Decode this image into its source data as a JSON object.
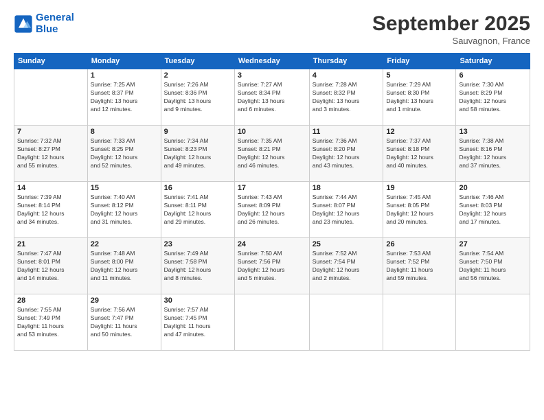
{
  "logo": {
    "line1": "General",
    "line2": "Blue"
  },
  "title": "September 2025",
  "location": "Sauvagnon, France",
  "days_header": [
    "Sunday",
    "Monday",
    "Tuesday",
    "Wednesday",
    "Thursday",
    "Friday",
    "Saturday"
  ],
  "weeks": [
    [
      {
        "num": "",
        "info": ""
      },
      {
        "num": "1",
        "info": "Sunrise: 7:25 AM\nSunset: 8:37 PM\nDaylight: 13 hours\nand 12 minutes."
      },
      {
        "num": "2",
        "info": "Sunrise: 7:26 AM\nSunset: 8:36 PM\nDaylight: 13 hours\nand 9 minutes."
      },
      {
        "num": "3",
        "info": "Sunrise: 7:27 AM\nSunset: 8:34 PM\nDaylight: 13 hours\nand 6 minutes."
      },
      {
        "num": "4",
        "info": "Sunrise: 7:28 AM\nSunset: 8:32 PM\nDaylight: 13 hours\nand 3 minutes."
      },
      {
        "num": "5",
        "info": "Sunrise: 7:29 AM\nSunset: 8:30 PM\nDaylight: 13 hours\nand 1 minute."
      },
      {
        "num": "6",
        "info": "Sunrise: 7:30 AM\nSunset: 8:29 PM\nDaylight: 12 hours\nand 58 minutes."
      }
    ],
    [
      {
        "num": "7",
        "info": "Sunrise: 7:32 AM\nSunset: 8:27 PM\nDaylight: 12 hours\nand 55 minutes."
      },
      {
        "num": "8",
        "info": "Sunrise: 7:33 AM\nSunset: 8:25 PM\nDaylight: 12 hours\nand 52 minutes."
      },
      {
        "num": "9",
        "info": "Sunrise: 7:34 AM\nSunset: 8:23 PM\nDaylight: 12 hours\nand 49 minutes."
      },
      {
        "num": "10",
        "info": "Sunrise: 7:35 AM\nSunset: 8:21 PM\nDaylight: 12 hours\nand 46 minutes."
      },
      {
        "num": "11",
        "info": "Sunrise: 7:36 AM\nSunset: 8:20 PM\nDaylight: 12 hours\nand 43 minutes."
      },
      {
        "num": "12",
        "info": "Sunrise: 7:37 AM\nSunset: 8:18 PM\nDaylight: 12 hours\nand 40 minutes."
      },
      {
        "num": "13",
        "info": "Sunrise: 7:38 AM\nSunset: 8:16 PM\nDaylight: 12 hours\nand 37 minutes."
      }
    ],
    [
      {
        "num": "14",
        "info": "Sunrise: 7:39 AM\nSunset: 8:14 PM\nDaylight: 12 hours\nand 34 minutes."
      },
      {
        "num": "15",
        "info": "Sunrise: 7:40 AM\nSunset: 8:12 PM\nDaylight: 12 hours\nand 31 minutes."
      },
      {
        "num": "16",
        "info": "Sunrise: 7:41 AM\nSunset: 8:11 PM\nDaylight: 12 hours\nand 29 minutes."
      },
      {
        "num": "17",
        "info": "Sunrise: 7:43 AM\nSunset: 8:09 PM\nDaylight: 12 hours\nand 26 minutes."
      },
      {
        "num": "18",
        "info": "Sunrise: 7:44 AM\nSunset: 8:07 PM\nDaylight: 12 hours\nand 23 minutes."
      },
      {
        "num": "19",
        "info": "Sunrise: 7:45 AM\nSunset: 8:05 PM\nDaylight: 12 hours\nand 20 minutes."
      },
      {
        "num": "20",
        "info": "Sunrise: 7:46 AM\nSunset: 8:03 PM\nDaylight: 12 hours\nand 17 minutes."
      }
    ],
    [
      {
        "num": "21",
        "info": "Sunrise: 7:47 AM\nSunset: 8:01 PM\nDaylight: 12 hours\nand 14 minutes."
      },
      {
        "num": "22",
        "info": "Sunrise: 7:48 AM\nSunset: 8:00 PM\nDaylight: 12 hours\nand 11 minutes."
      },
      {
        "num": "23",
        "info": "Sunrise: 7:49 AM\nSunset: 7:58 PM\nDaylight: 12 hours\nand 8 minutes."
      },
      {
        "num": "24",
        "info": "Sunrise: 7:50 AM\nSunset: 7:56 PM\nDaylight: 12 hours\nand 5 minutes."
      },
      {
        "num": "25",
        "info": "Sunrise: 7:52 AM\nSunset: 7:54 PM\nDaylight: 12 hours\nand 2 minutes."
      },
      {
        "num": "26",
        "info": "Sunrise: 7:53 AM\nSunset: 7:52 PM\nDaylight: 11 hours\nand 59 minutes."
      },
      {
        "num": "27",
        "info": "Sunrise: 7:54 AM\nSunset: 7:50 PM\nDaylight: 11 hours\nand 56 minutes."
      }
    ],
    [
      {
        "num": "28",
        "info": "Sunrise: 7:55 AM\nSunset: 7:49 PM\nDaylight: 11 hours\nand 53 minutes."
      },
      {
        "num": "29",
        "info": "Sunrise: 7:56 AM\nSunset: 7:47 PM\nDaylight: 11 hours\nand 50 minutes."
      },
      {
        "num": "30",
        "info": "Sunrise: 7:57 AM\nSunset: 7:45 PM\nDaylight: 11 hours\nand 47 minutes."
      },
      {
        "num": "",
        "info": ""
      },
      {
        "num": "",
        "info": ""
      },
      {
        "num": "",
        "info": ""
      },
      {
        "num": "",
        "info": ""
      }
    ]
  ]
}
